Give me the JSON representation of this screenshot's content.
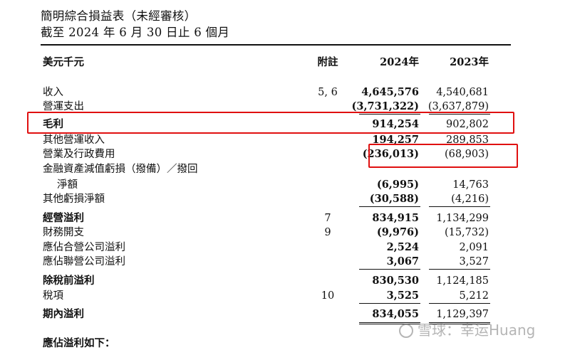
{
  "title_line1": "簡明綜合損益表（未經審核）",
  "title_line2": "截至 2024 年 6 月 30 日止 6 個月",
  "header": {
    "unit": "美元千元",
    "note": "附註",
    "y2024": "2024年",
    "y2023": "2023年"
  },
  "rows": [
    {
      "label": "收入",
      "note": "5, 6",
      "v2024": "4,645,576",
      "v2023": "4,540,681"
    },
    {
      "label": "營運支出",
      "note": "",
      "v2024": "(3,731,322)",
      "v2023": "(3,637,879)"
    },
    {
      "label": "毛利",
      "note": "",
      "v2024": "914,254",
      "v2023": "902,802"
    },
    {
      "label": "其他營運收入",
      "note": "",
      "v2024": "194,257",
      "v2023": "289,853"
    },
    {
      "label": "營業及行政費用",
      "note": "",
      "v2024": "(236,013)",
      "v2023": "(68,903)"
    },
    {
      "label": "金融資產減值虧損（撥備）／撥回",
      "note": "",
      "v2024": "",
      "v2023": ""
    },
    {
      "label": "淨額",
      "note": "",
      "v2024": "(6,995)",
      "v2023": "14,763"
    },
    {
      "label": "其他虧損淨額",
      "note": "",
      "v2024": "(30,588)",
      "v2023": "(4,216)"
    },
    {
      "label": "經營溢利",
      "note": "7",
      "v2024": "834,915",
      "v2023": "1,134,299"
    },
    {
      "label": "財務開支",
      "note": "9",
      "v2024": "(9,976)",
      "v2023": "(15,732)"
    },
    {
      "label": "應佔合營公司溢利",
      "note": "",
      "v2024": "2,524",
      "v2023": "2,091"
    },
    {
      "label": "應佔聯營公司溢利",
      "note": "",
      "v2024": "3,067",
      "v2023": "3,527"
    },
    {
      "label": "除稅前溢利",
      "note": "",
      "v2024": "830,530",
      "v2023": "1,124,185"
    },
    {
      "label": "稅項",
      "note": "10",
      "v2024": "3,525",
      "v2023": "5,212"
    },
    {
      "label": "期內溢利",
      "note": "",
      "v2024": "834,055",
      "v2023": "1,129,397"
    },
    {
      "label": "應佔溢利如下：",
      "note": "",
      "v2024": "",
      "v2023": ""
    }
  ],
  "watermark": "雪球：幸运Huang",
  "highlight_color": "#e01010"
}
